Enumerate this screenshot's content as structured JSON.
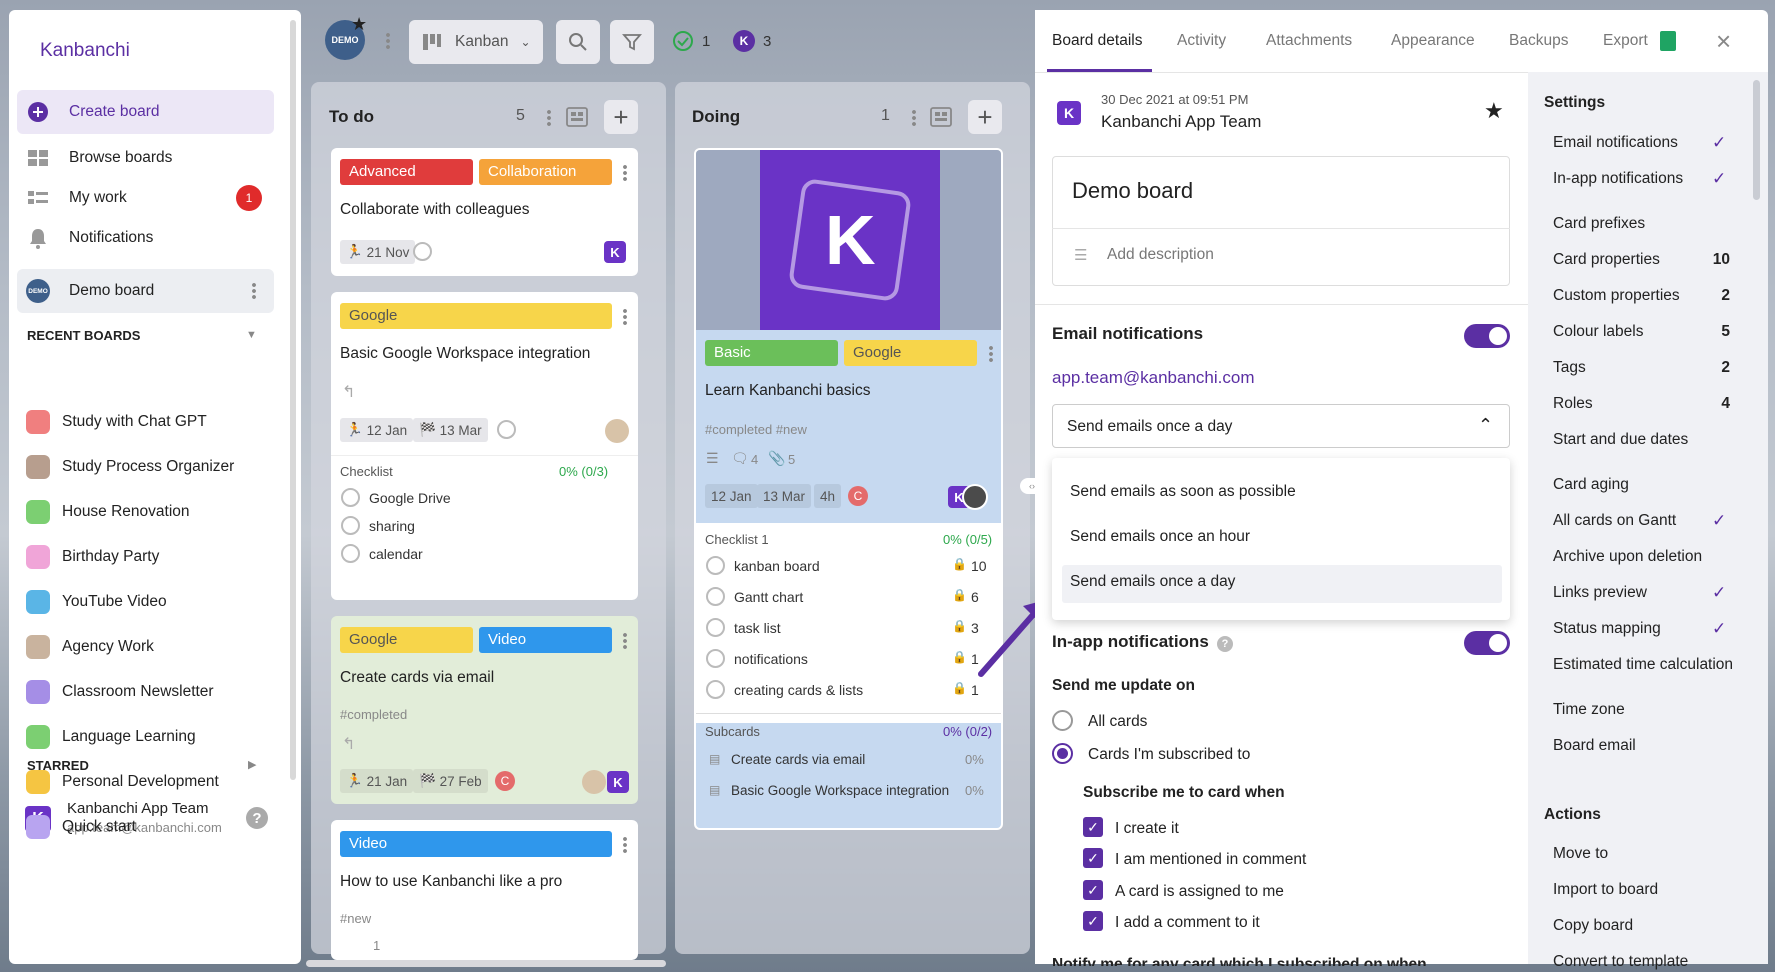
{
  "sidebar": {
    "logo": "Kanbanchi",
    "create_board": "Create board",
    "items": [
      {
        "label": "Browse boards",
        "icon": "browse-boards-icon"
      },
      {
        "label": "My work",
        "icon": "my-work-icon",
        "badge": "1"
      },
      {
        "label": "Notifications",
        "icon": "bell-icon"
      }
    ],
    "current_board": {
      "label": "Demo board",
      "icon_text": "DEMO"
    },
    "recent_header": "RECENT BOARDS",
    "recent_boards": [
      {
        "label": "Study with Chat GPT",
        "color": "#f07f7f"
      },
      {
        "label": "Study Process Organizer",
        "color": "#b79e8e"
      },
      {
        "label": "House Renovation",
        "color": "#7ccf72"
      },
      {
        "label": "Birthday Party",
        "color": "#f0a5d8"
      },
      {
        "label": "YouTube Video",
        "color": "#5ab5e6"
      },
      {
        "label": "Agency Work",
        "color": "#c9b39e"
      },
      {
        "label": "Classroom Newsletter",
        "color": "#a58ee6"
      },
      {
        "label": "Language Learning",
        "color": "#7ccf72"
      },
      {
        "label": "Personal Development",
        "color": "#f5c542"
      },
      {
        "label": "Quick start",
        "color": "#b8a4f0"
      }
    ],
    "starred_header": "STARRED",
    "user": {
      "name": "Kanbanchi App Team",
      "email": "app.team@kanbanchi.com"
    }
  },
  "toolbar": {
    "view": "Kanban",
    "done_count": "1",
    "k_count": "3",
    "board_icon_text": "DEMO"
  },
  "columns": [
    {
      "title": "To do",
      "count": "5",
      "cards": [
        {
          "tags": [
            "Advanced",
            "Collaboration"
          ],
          "title": "Collaborate with colleagues",
          "dates": [
            "21 Nov"
          ]
        },
        {
          "tags": [
            "Google"
          ],
          "title": "Basic Google Workspace integration",
          "dates": [
            "12 Jan",
            "13 Mar"
          ],
          "checklist_label": "Checklist",
          "checklist_progress": "0% (0/3)",
          "checklist": [
            "Google Drive",
            "sharing",
            "calendar"
          ]
        },
        {
          "tags": [
            "Google",
            "Video"
          ],
          "title": "Create cards via email",
          "hashtags": "#completed",
          "dates": [
            "21 Jan",
            "27 Feb"
          ]
        },
        {
          "tags": [
            "Video"
          ],
          "title": "How to use Kanbanchi like a pro",
          "hashtags": "#new",
          "counts": "1"
        }
      ]
    },
    {
      "title": "Doing",
      "count": "1",
      "cards": [
        {
          "tags": [
            "Basic",
            "Google"
          ],
          "title": "Learn Kanbanchi basics",
          "hashtags": "#completed #new",
          "comments": "4",
          "attachments": "5",
          "dates": [
            "12 Jan",
            "13 Mar",
            "4h"
          ],
          "checklist_label": "Checklist 1",
          "checklist_progress": "0% (0/5)",
          "checklist": [
            {
              "label": "kanban board",
              "n": "10"
            },
            {
              "label": "Gantt chart",
              "n": "6"
            },
            {
              "label": "task list",
              "n": "3"
            },
            {
              "label": "notifications",
              "n": "1"
            },
            {
              "label": "creating cards & lists",
              "n": "1"
            }
          ],
          "subcards_label": "Subcards",
          "subcards_progress": "0% (0/2)",
          "subcards": [
            {
              "label": "Create cards via email",
              "pct": "0%"
            },
            {
              "label": "Basic Google Workspace integration",
              "pct": "0%"
            }
          ]
        }
      ]
    }
  ],
  "panel": {
    "tabs": [
      "Board details",
      "Activity",
      "Attachments",
      "Appearance",
      "Backups",
      "Export"
    ],
    "timestamp": "30 Dec 2021 at 09:51 PM",
    "owner": "Kanbanchi App Team",
    "board_name": "Demo board",
    "add_description": "Add description",
    "email_section": "Email notifications",
    "email": "app.team@kanbanchi.com",
    "frequency_selected": "Send emails once a day",
    "frequency_options": [
      "Send emails as soon as possible",
      "Send emails once an hour",
      "Send emails once a day"
    ],
    "inapp_section": "In-app notifications",
    "send_update_on": "Send me update on",
    "radio_all": "All cards",
    "radio_subscribed": "Cards I'm subscribed to",
    "subscribe_when": "Subscribe me to card when",
    "checks": [
      "I create it",
      "I am mentioned in comment",
      "A card is assigned to me",
      "I add a comment to it"
    ],
    "cut_text": "Notify me for any card which I subscribed on when"
  },
  "settings": {
    "header": "Settings",
    "items": [
      {
        "label": "Email notifications",
        "check": true
      },
      {
        "label": "In-app notifications",
        "check": true
      },
      {
        "label": "Card prefixes"
      },
      {
        "label": "Card properties",
        "count": "10"
      },
      {
        "label": "Custom properties",
        "count": "2"
      },
      {
        "label": "Colour labels",
        "count": "5"
      },
      {
        "label": "Tags",
        "count": "2"
      },
      {
        "label": "Roles",
        "count": "4"
      },
      {
        "label": "Start and due dates"
      },
      {
        "label": "Card aging"
      },
      {
        "label": "All cards on Gantt",
        "check": true
      },
      {
        "label": "Archive upon deletion"
      },
      {
        "label": "Links preview",
        "check": true
      },
      {
        "label": "Status mapping",
        "check": true
      },
      {
        "label": "Estimated time calculation"
      },
      {
        "label": "Time zone"
      },
      {
        "label": "Board email"
      }
    ],
    "actions_header": "Actions",
    "actions": [
      "Move to",
      "Import to board",
      "Copy board",
      "Convert to template"
    ]
  },
  "colors": {
    "accent": "#5b2fa3",
    "advanced": "#e03c3c",
    "collaboration": "#f5a33a",
    "google": "#f7d54a",
    "video": "#2f97ec",
    "basic": "#6bbf5a"
  }
}
